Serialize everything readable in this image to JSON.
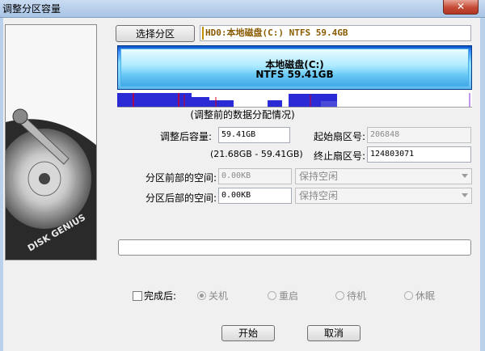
{
  "window": {
    "title": "调整分区容量",
    "close_label": "✕"
  },
  "select_partition_label": "选择分区",
  "disk_info": "HD0:本地磁盘(C:) NTFS 59.4GB",
  "partition": {
    "name": "本地磁盘(C:)",
    "detail": "NTFS 59.41GB"
  },
  "distribution_caption": "(调整前的数据分配情况)",
  "form": {
    "new_size_label": "调整后容量:",
    "new_size_value": "59.41GB",
    "size_range": "(21.68GB - 59.41GB)",
    "start_sector_label": "起始扇区号:",
    "start_sector_value": "206848",
    "end_sector_label": "终止扇区号:",
    "end_sector_value": "124803071",
    "space_before_label": "分区前部的空间:",
    "space_before_value": "0.00KB",
    "space_before_option": "保持空闲",
    "space_after_label": "分区后部的空间:",
    "space_after_value": "0.00KB",
    "space_after_option": "保持空闲"
  },
  "after_done": {
    "checkbox_label": "完成后:",
    "options": [
      "关机",
      "重启",
      "待机",
      "休眠"
    ],
    "selected": 0
  },
  "buttons": {
    "start": "开始",
    "cancel": "取消"
  },
  "colors": {
    "partition_bar": "#5fc3f3",
    "used_data": "#2b2bd6",
    "marker_red": "#d0002a"
  }
}
